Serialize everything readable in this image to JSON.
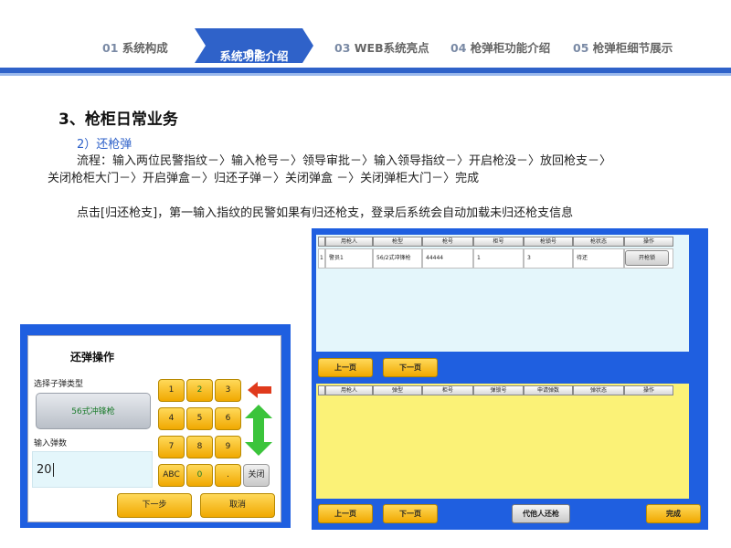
{
  "nav": {
    "items": [
      {
        "num": "01",
        "label": "系统构成"
      },
      {
        "num": "02",
        "label": "系统功能介绍"
      },
      {
        "num": "03",
        "label": "WEB系统亮点"
      },
      {
        "num": "04",
        "label": "枪弹柜功能介绍"
      },
      {
        "num": "05",
        "label": "枪弹柜细节展示"
      }
    ],
    "active_index": 1,
    "active_color": "#2f62c9"
  },
  "content": {
    "section_title": "3、枪柜日常业务",
    "sub_title": "2）还枪弹",
    "flow_line1": "流程：输入两位民警指纹－〉输入枪号－〉领导审批－〉输入领导指纹－〉开启枪没－〉放回枪支－〉",
    "flow_line2": "关闭枪柜大门－〉开启弹盒－〉归还子弹－〉关闭弹盒 －〉关闭弹柜大门－〉完成",
    "description": "点击[归还枪支]，第一输入指纹的民警如果有归还枪支，登录后系统会自动加载未归还枪支信息"
  },
  "dialog": {
    "title": "还弹操作",
    "type_label": "选择子弹类型",
    "type_value": "56式冲锋枪",
    "count_label": "输入弹数",
    "count_value": "20",
    "keys": [
      "1",
      "2",
      "3",
      "4",
      "5",
      "6",
      "7",
      "8",
      "9",
      "ABC",
      "0",
      ".",
      "关闭"
    ],
    "next_label": "下一步",
    "cancel_label": "取消"
  },
  "gun_table": {
    "headers": [
      "用枪人",
      "枪型",
      "枪号",
      "柜号",
      "枪锁号",
      "枪状态",
      "操作"
    ],
    "rows": [
      {
        "user": "警员1",
        "model": "56/2式冲锋枪",
        "gun_no": "44444",
        "cabinet": "1",
        "lock_no": "3",
        "status": "待还",
        "action": "开枪锁"
      }
    ],
    "row_index": "1"
  },
  "ammo_table": {
    "headers": [
      "用枪人",
      "弹型",
      "柜号",
      "弹锁号",
      "申请弹数",
      "弹状态",
      "操作"
    ]
  },
  "buttons": {
    "prev": "上一页",
    "next": "下一页",
    "proxy_return": "代他人还枪",
    "finish": "完成"
  }
}
